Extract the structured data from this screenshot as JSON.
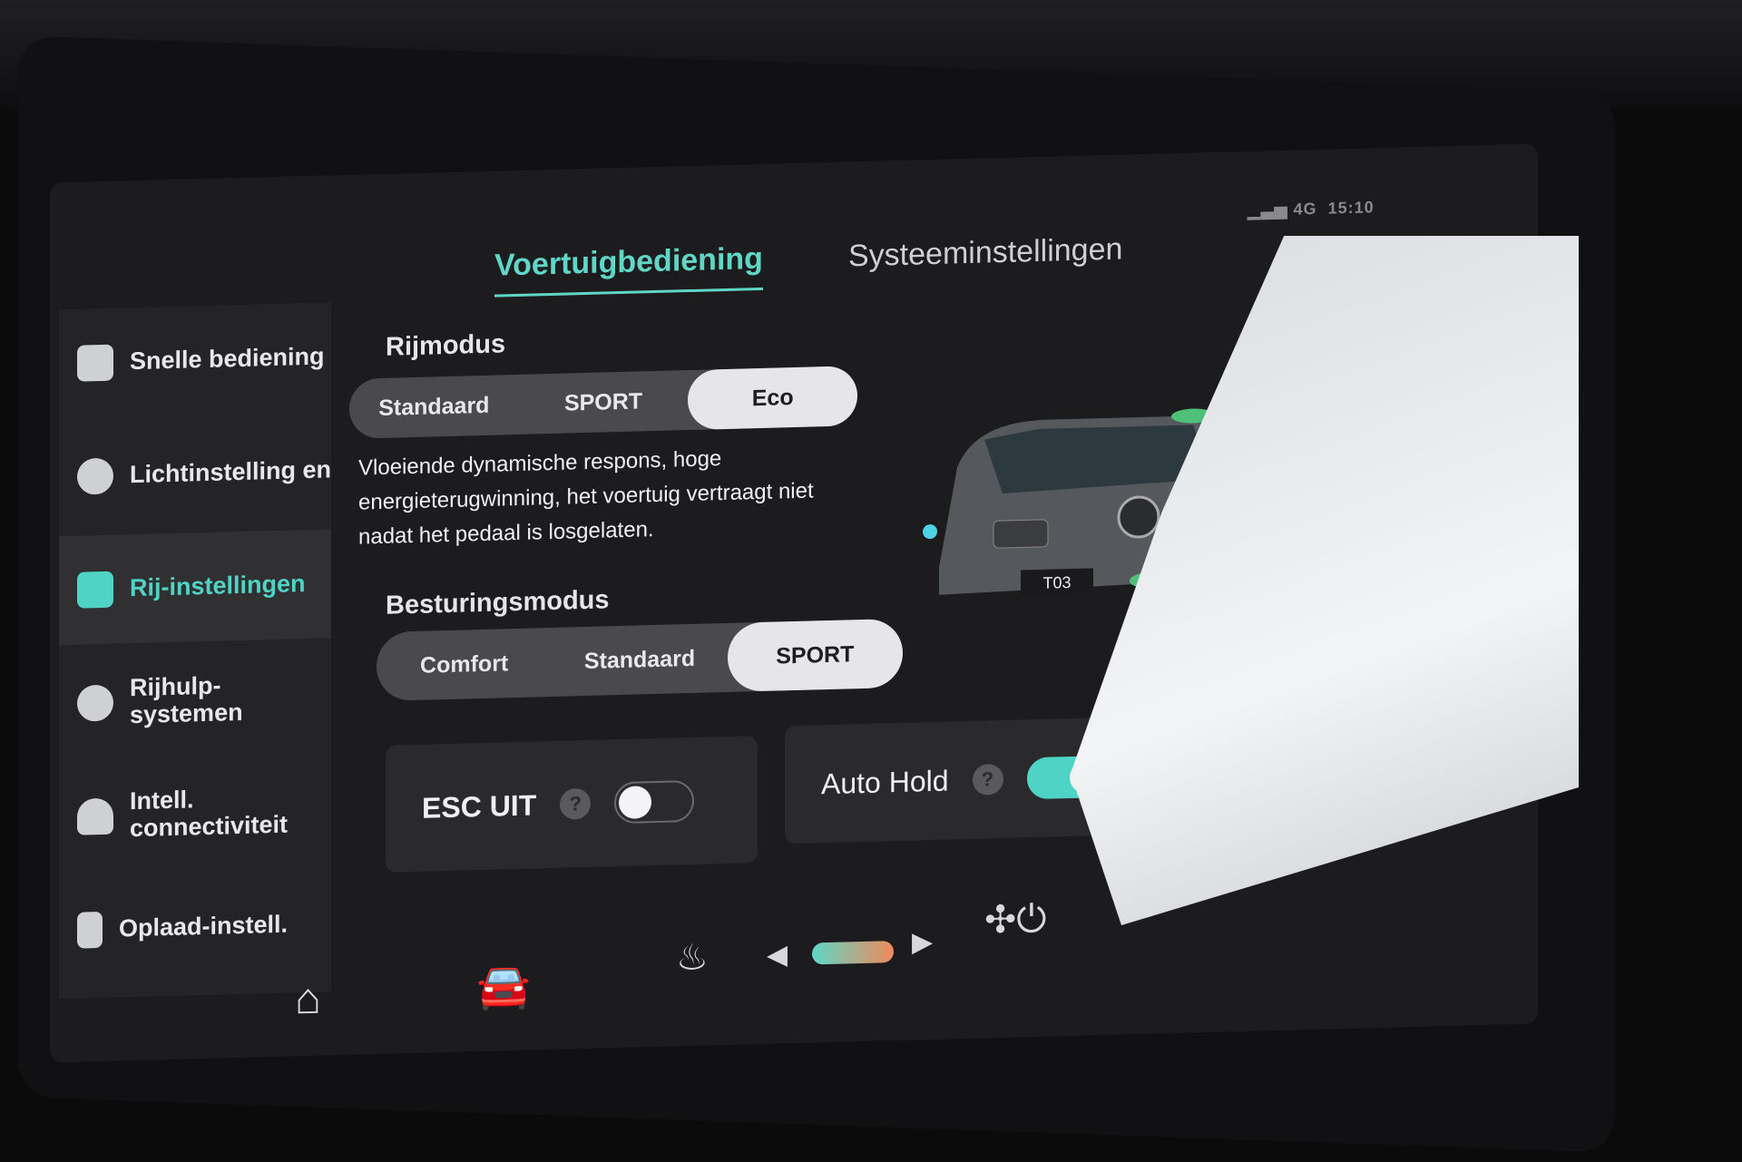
{
  "status_bar": {
    "signal": "4G",
    "time": "15:10"
  },
  "tabs": [
    {
      "label": "Voertuigbediening",
      "active": true
    },
    {
      "label": "Systeeminstellingen",
      "active": false
    }
  ],
  "sidebar": {
    "items": [
      {
        "label": "Snelle bediening",
        "icon": "toggles-icon",
        "active": false
      },
      {
        "label": "Lichtinstelling en",
        "icon": "light-bulb-icon",
        "active": false
      },
      {
        "label": "Rij-instellingen",
        "icon": "grid-icon",
        "active": true
      },
      {
        "label": "Rijhulp-systemen",
        "icon": "steering-wheel-icon",
        "active": false
      },
      {
        "label": "Intell. connectiviteit",
        "icon": "cloud-icon",
        "active": false
      },
      {
        "label": "Oplaad-instell.",
        "icon": "battery-icon",
        "active": false
      }
    ]
  },
  "rijmodus": {
    "title": "Rijmodus",
    "options": [
      "Standaard",
      "SPORT",
      "Eco"
    ],
    "selected": "Eco",
    "description": "Vloeiende dynamische respons, hoge energieterugwinning, het voertuig vertraagt niet nadat het pedaal is losgelaten."
  },
  "besturingsmodus": {
    "title": "Besturingsmodus",
    "options": [
      "Comfort",
      "Standaard",
      "SPORT"
    ],
    "selected": "SPORT"
  },
  "esc": {
    "label": "ESC UIT",
    "help": "?",
    "on": false
  },
  "auto_hold": {
    "label": "Auto Hold",
    "help": "?",
    "on": true
  },
  "vehicle_image": {
    "plate": "T03"
  },
  "colors": {
    "accent": "#4fd3c5",
    "background": "#1c1c1e"
  },
  "bottom_bar": {
    "icons": [
      "home-icon",
      "car-icon",
      "front-defrost-icon",
      "temp-left-arrow-icon",
      "temperature-slider",
      "temp-right-arrow-icon",
      "fan-power-icon",
      "rear-defrost-icon"
    ]
  }
}
